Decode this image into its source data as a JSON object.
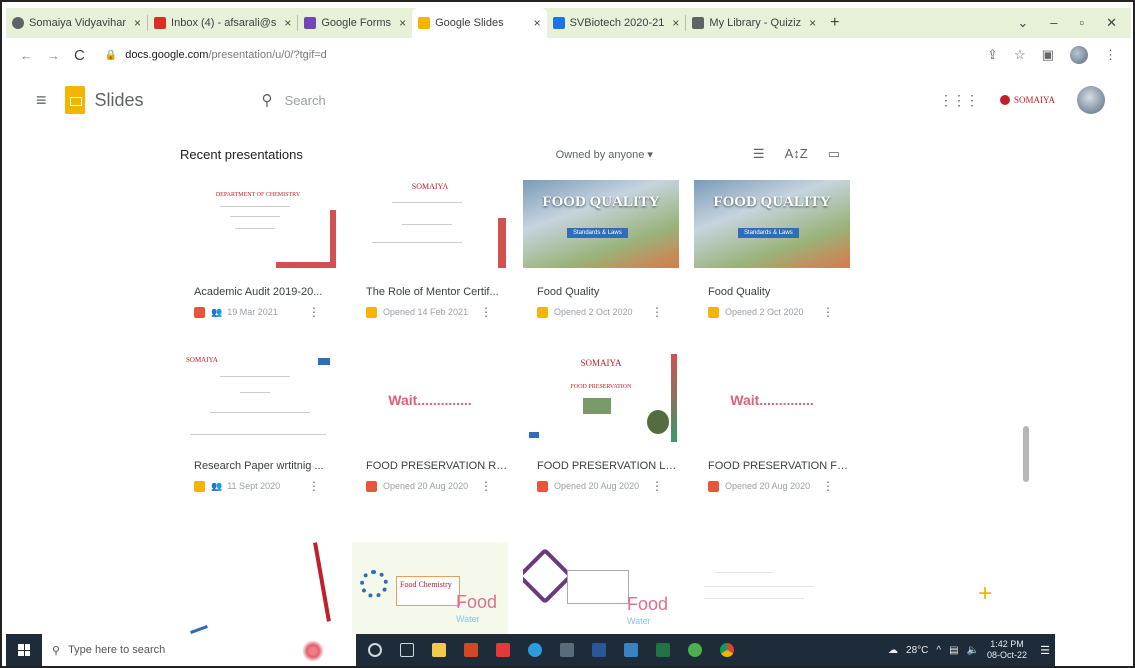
{
  "browser": {
    "tabs": [
      {
        "label": "Somaiya Vidyavihar",
        "color": "#5f6368",
        "active": false
      },
      {
        "label": "Inbox (4) - afsarali@s",
        "color": "#d93025",
        "active": false
      },
      {
        "label": "Google Forms",
        "color": "#7248b9",
        "active": false
      },
      {
        "label": "Google Slides",
        "color": "#f4b400",
        "active": true
      },
      {
        "label": "SVBiotech 2020-21",
        "color": "#1a73e8",
        "active": false
      },
      {
        "label": "My Library - Quiziz",
        "color": "#5f6368",
        "active": false
      }
    ],
    "close_glyph": "×",
    "new_tab_glyph": "+",
    "url_host": "docs.google.com",
    "url_path": "/presentation/u/0/?tgif=d"
  },
  "app": {
    "title": "Slides",
    "search_placeholder": "Search",
    "org_name": "SOMAIYA"
  },
  "list": {
    "heading": "Recent presentations",
    "owner_filter": "Owned by anyone ▾"
  },
  "thumbs": {
    "dept_chem": "DEPARTMENT OF CHEMISTRY",
    "somaiya": "SOMAIYA",
    "food_quality": "FOOD QUALITY",
    "food_quality_sub": "Standards & Laws",
    "wait": "Wait..............",
    "food_preservation": "FOOD PRESERVATION",
    "food_chemistry": "Food Chemistry",
    "food": "Food",
    "water": "Water"
  },
  "files": [
    {
      "title": "Academic Audit 2019-20...",
      "meta": "19 Mar 2021",
      "type": "ppt",
      "shared": true
    },
    {
      "title": "The Role of Mentor Certif...",
      "meta": "Opened 14 Feb 2021",
      "type": "slides",
      "shared": false
    },
    {
      "title": "Food Quality",
      "meta": "Opened 2 Oct 2020",
      "type": "slides",
      "shared": false
    },
    {
      "title": "Food Quality",
      "meta": "Opened 2 Oct 2020",
      "type": "slides",
      "shared": false
    },
    {
      "title": "Research Paper wrtitnig ...",
      "meta": "11 Sept 2020",
      "type": "slides",
      "shared": true
    },
    {
      "title": "FOOD PRESERVATION RA...",
      "meta": "Opened 20 Aug 2020",
      "type": "ppt",
      "shared": false
    },
    {
      "title": "FOOD PRESERVATION LO...",
      "meta": "Opened 20 Aug 2020",
      "type": "ppt",
      "shared": false
    },
    {
      "title": "FOOD PRESERVATION FE...",
      "meta": "Opened 20 Aug 2020",
      "type": "ppt",
      "shared": false
    }
  ],
  "taskbar": {
    "search_placeholder": "Type here to search",
    "weather": "28°C",
    "time": "1:42 PM",
    "date": "08-Oct-22"
  },
  "colors": {
    "tab_strip": "#e6f1d8",
    "slides_yellow": "#f4b400",
    "ppt_orange": "#e8553a",
    "taskbar": "#1e2b38"
  }
}
